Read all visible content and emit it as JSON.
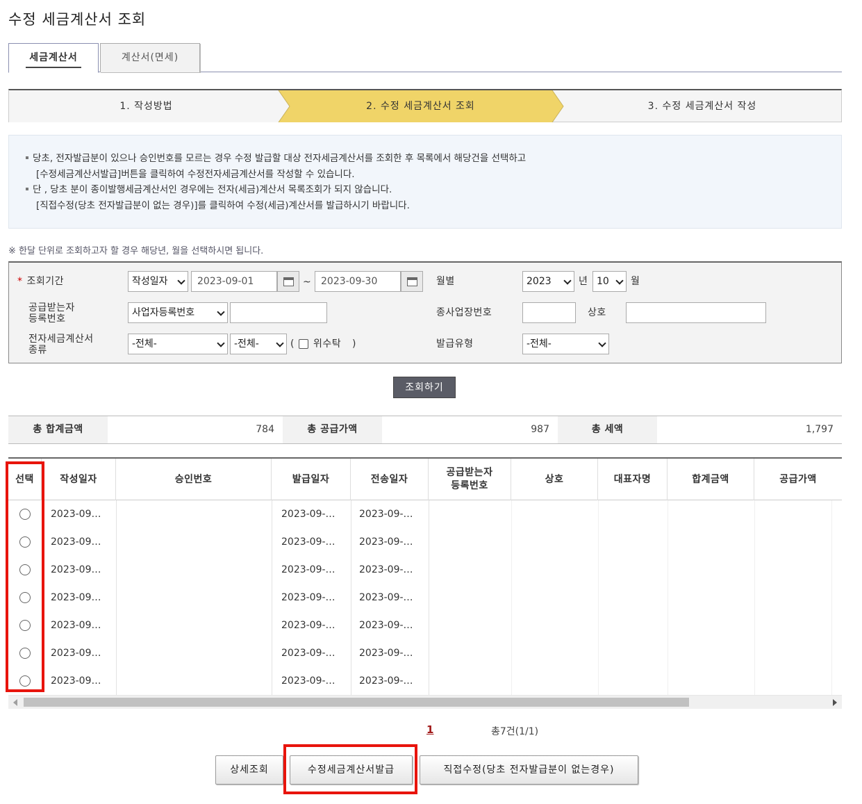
{
  "title": "수정 세금계산서 조회",
  "tabs": [
    {
      "label": "세금계산서",
      "active": true
    },
    {
      "label": "계산서(면세)",
      "active": false
    }
  ],
  "steps": [
    "1. 작성방법",
    "2. 수정 세금계산서 조회",
    "3. 수정 세금계산서 작성"
  ],
  "info": {
    "line1": "당초, 전자발급분이 있으나 승인번호를 모르는 경우 수정 발급할 대상 전자세금계산서를 조회한 후 목록에서 해당건을 선택하고",
    "line2": "[수정세금계산서발급]버튼을 클릭하여 수정전자세금계산서를 작성할 수 있습니다.",
    "line3": "단 , 당초 분이 종이발행세금계산서인 경우에는 전자(세금)계산서 목록조회가 되지 않습니다.",
    "line4": "[직접수정(당초 전자발급분이 없는 경우)]를 클릭하여 수정(세금)계산서를 발급하시기 바랍니다."
  },
  "notice": "※ 한달 단위로 조회하고자 할 경우 해당년, 월을 선택하시면 됩니다.",
  "search": {
    "period_label": "조회기간",
    "required_mark": "*",
    "period_type": "작성일자",
    "date_from": "2023-09-01",
    "tilde": "~",
    "date_to": "2023-09-30",
    "month_label": "월별",
    "year": "2023",
    "year_suffix": "년",
    "month": "10",
    "month_suffix": "월",
    "recipient_label_1": "공급받는자",
    "recipient_label_2": "등록번호",
    "recipient_type": "사업자등록번호",
    "recipient_value": "",
    "sub_biz_label": "종사업장번호",
    "sub_biz_value": "",
    "company_label": "상호",
    "company_value": "",
    "kind_label_1": "전자세금계산서",
    "kind_label_2": "종류",
    "kind_1": "-전체-",
    "kind_2": "-전체-",
    "trust_open": "(",
    "trust_label": "위수탁",
    "trust_close": ")",
    "issue_type_label": "발급유형",
    "issue_type": "-전체-",
    "button": "조회하기"
  },
  "totals": {
    "sum_label": "총 합계금액",
    "sum_value": "784",
    "supply_label": "총 공급가액",
    "supply_value": "987",
    "tax_label": "총 세액",
    "tax_value": "1,797"
  },
  "table": {
    "headers": {
      "select": "선택",
      "written": "작성일자",
      "approval": "승인번호",
      "issued": "발급일자",
      "sent": "전송일자",
      "recipient_1": "공급받는자",
      "recipient_2": "등록번호",
      "company": "상호",
      "ceo": "대표자명",
      "total": "합계금액",
      "supply": "공급가액"
    },
    "rows": [
      {
        "written": "2023-09…",
        "issued": "2023-09-…",
        "sent": "2023-09-…"
      },
      {
        "written": "2023-09…",
        "issued": "2023-09-…",
        "sent": "2023-09-…"
      },
      {
        "written": "2023-09…",
        "issued": "2023-09-…",
        "sent": "2023-09-…"
      },
      {
        "written": "2023-09…",
        "issued": "2023-09-…",
        "sent": "2023-09-…"
      },
      {
        "written": "2023-09…",
        "issued": "2023-09-…",
        "sent": "2023-09-…"
      },
      {
        "written": "2023-09…",
        "issued": "2023-09-…",
        "sent": "2023-09-…"
      },
      {
        "written": "2023-09…",
        "issued": "2023-09-…",
        "sent": "2023-09-…"
      }
    ]
  },
  "pagination": {
    "current": "1",
    "total": "총7건(1/1)"
  },
  "buttons": {
    "detail": "상세조회",
    "issue": "수정세금계산서발급",
    "direct": "직접수정(당초 전자발급분이 없는경우)"
  },
  "colors": {
    "accent": "#f0d468",
    "highlight": "#e8140c"
  }
}
